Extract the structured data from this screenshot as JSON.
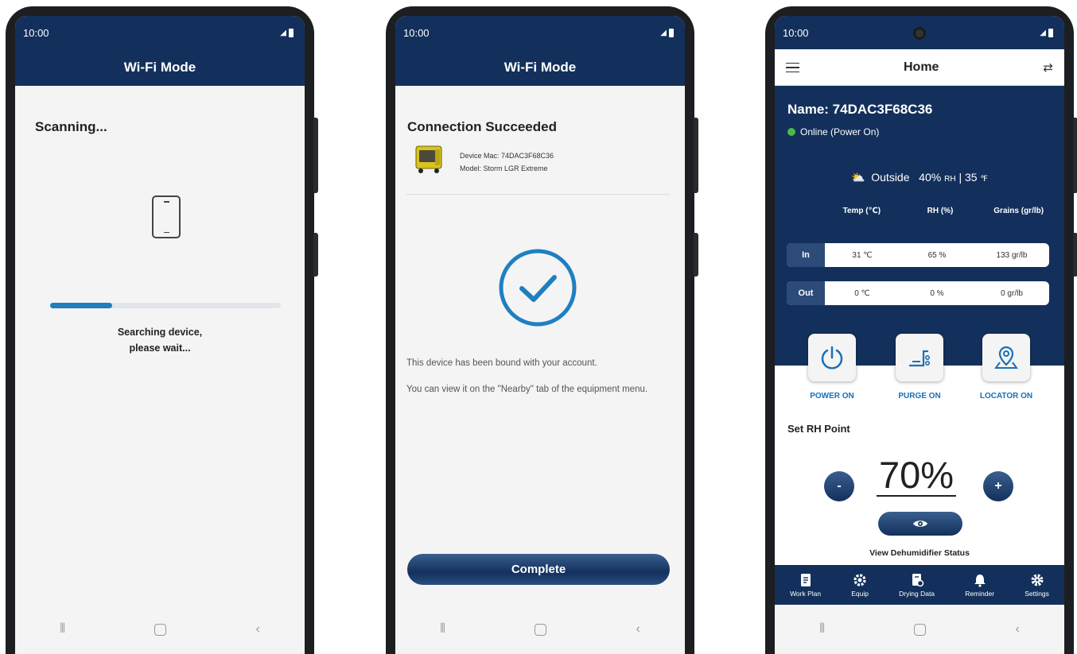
{
  "phone1": {
    "time": "10:00",
    "title": "Wi-Fi Mode",
    "heading": "Scanning...",
    "progress": 0.27,
    "message_line1": "Searching device,",
    "message_line2": "please wait...",
    "colors": {
      "bar": "#13305c",
      "progress": "#1f7fc0"
    }
  },
  "phone2": {
    "time": "10:00",
    "title": "Wi-Fi Mode",
    "heading": "Connection Succeeded",
    "device_mac": "Device Mac: 74DAC3F68C36",
    "device_model": "Model: Storm LGR Extreme",
    "bound_text": "This device has been bound with your account.",
    "nearby_text": "You can view it on the \"Nearby\" tab of the equipment menu.",
    "complete_label": "Complete",
    "colors": {
      "check": "#1f7fc0"
    }
  },
  "phone3": {
    "time": "10:00",
    "title": "Home",
    "device_name": "Name: 74DAC3F68C36",
    "status": "Online (Power On)",
    "outside_label": "Outside",
    "outside_rh": "40%",
    "outside_rh_unit": "RH",
    "outside_sep": "|",
    "outside_temp": "35",
    "outside_temp_unit": "℉",
    "table": {
      "headers": [
        "Temp (℃)",
        "RH (%)",
        "Grains (gr/lb)"
      ],
      "rows": [
        {
          "label": "In",
          "temp": "31 ℃",
          "rh": "65 %",
          "grains": "133 gr/lb"
        },
        {
          "label": "Out",
          "temp": "0 ℃",
          "rh": "0 %",
          "grains": "0 gr/lb"
        }
      ]
    },
    "controls": {
      "power": "POWER ON",
      "purge": "PURGE ON",
      "locator": "LOCATOR ON"
    },
    "set_rh_label": "Set RH Point",
    "minus": "-",
    "plus": "+",
    "rh_point": "70%",
    "view_status": "View Dehumidifier Status",
    "tabs": [
      "Work Plan",
      "Equip",
      "Drying Data",
      "Reminder",
      "Settings"
    ],
    "colors": {
      "panel": "#13305c",
      "accent": "#1b6fb6",
      "online": "#4cb944"
    }
  }
}
